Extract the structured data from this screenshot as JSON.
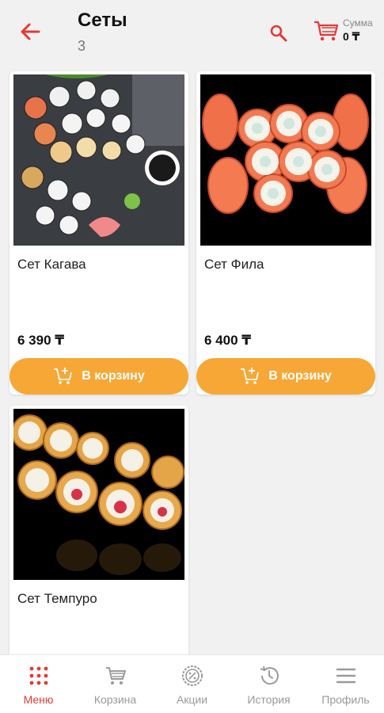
{
  "header": {
    "title": "Сеты",
    "count": "3",
    "sum_label": "Сумма",
    "sum_value": "0 ₸"
  },
  "colors": {
    "accent_red": "#e53935",
    "button_orange": "#f7a735"
  },
  "products": [
    {
      "name": "Сет Кагава",
      "price": "6 390 ₸",
      "button": "В корзину"
    },
    {
      "name": "Сет Фила",
      "price": "6 400 ₸",
      "button": "В корзину"
    },
    {
      "name": "Сет Темпуро"
    }
  ],
  "nav": {
    "items": [
      {
        "label": "Меню",
        "icon": "menu-grid-icon",
        "active": true
      },
      {
        "label": "Корзина",
        "icon": "cart-icon"
      },
      {
        "label": "Акции",
        "icon": "percent-badge-icon"
      },
      {
        "label": "История",
        "icon": "history-icon"
      },
      {
        "label": "Профиль",
        "icon": "hamburger-icon"
      }
    ]
  }
}
